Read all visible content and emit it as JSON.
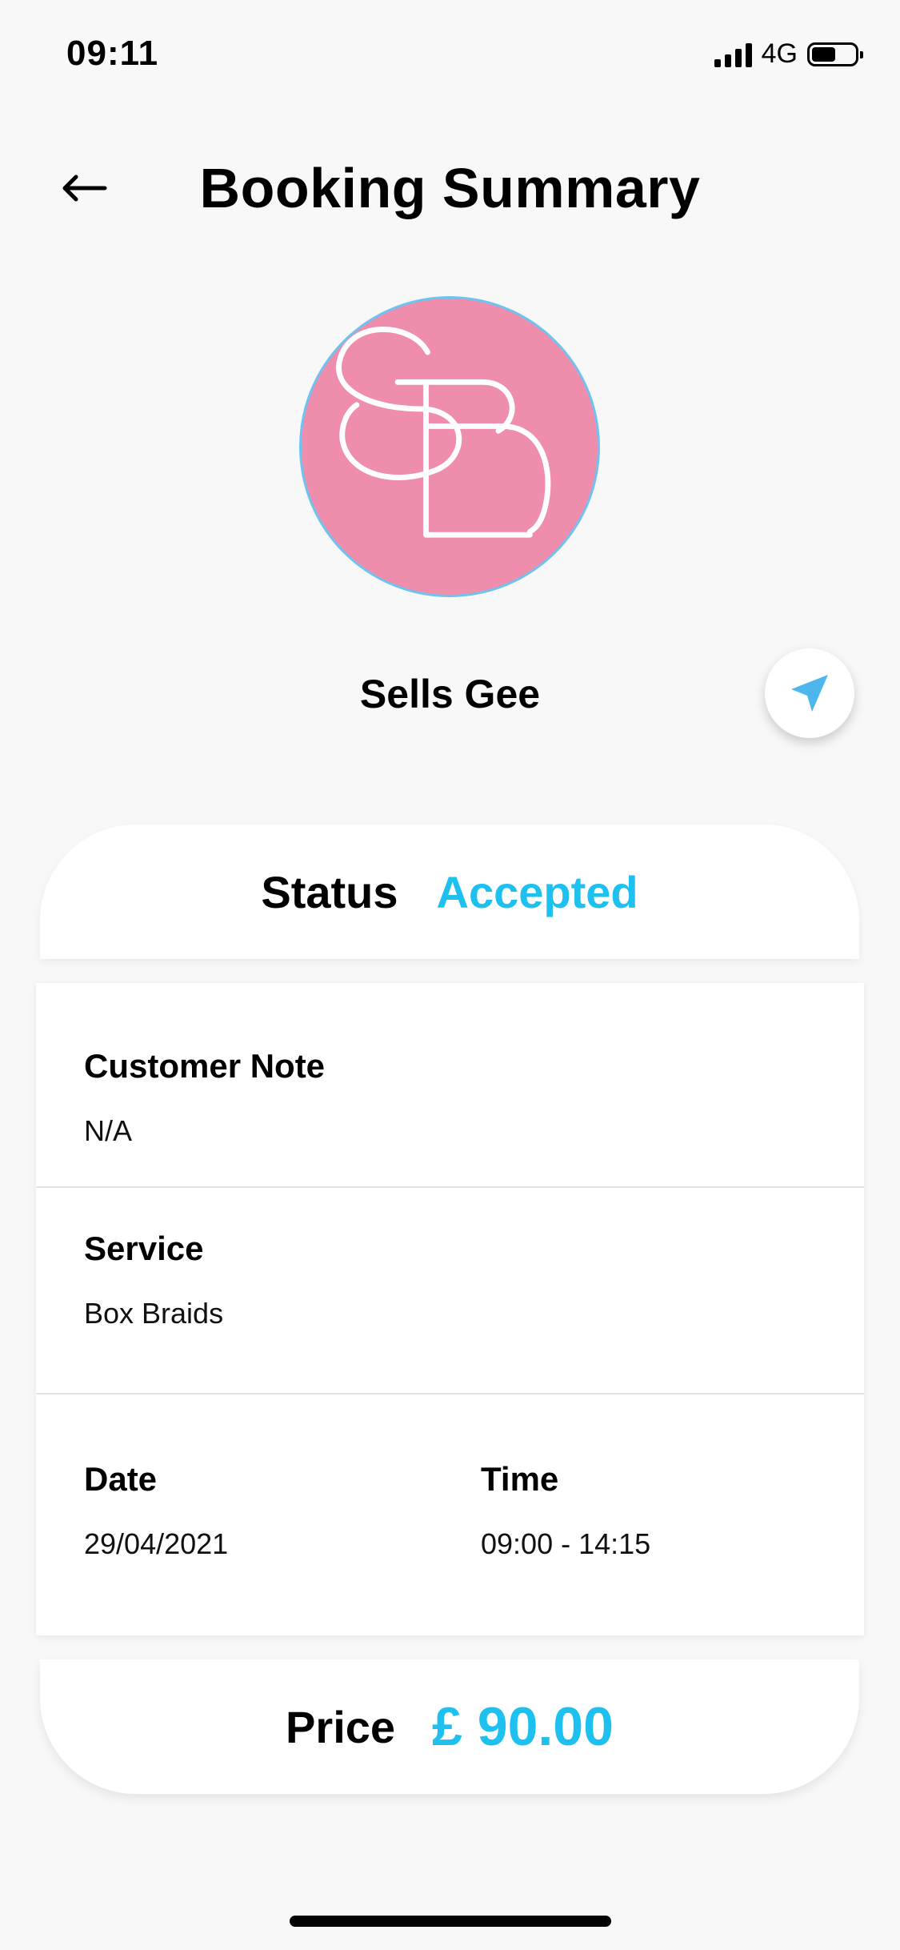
{
  "status_bar": {
    "time": "09:11",
    "network": "4G",
    "battery_level": 0.55
  },
  "header": {
    "title": "Booking Summary",
    "back_icon": "arrow-left-icon"
  },
  "profile": {
    "avatar_initials": "SG",
    "avatar_bg": "#ef8dad",
    "avatar_border": "#6ec3f0",
    "name": "Sells Gee",
    "nav_icon": "navigation-arrow-icon"
  },
  "status": {
    "label": "Status",
    "value": "Accepted",
    "value_color": "#1ec0f0"
  },
  "details": {
    "customer_note": {
      "label": "Customer Note",
      "value": "N/A"
    },
    "service": {
      "label": "Service",
      "value": "Box Braids"
    },
    "date": {
      "label": "Date",
      "value": "29/04/2021"
    },
    "time": {
      "label": "Time",
      "value": "09:00 - 14:15"
    }
  },
  "price": {
    "label": "Price",
    "value": "£ 90.00",
    "value_color": "#1ec0f0"
  }
}
